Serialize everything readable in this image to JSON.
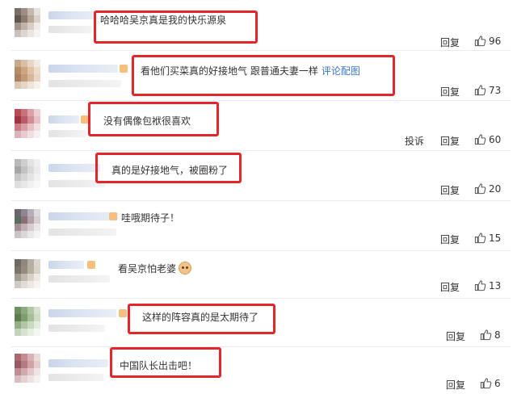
{
  "comments": [
    {
      "text": "哈哈哈吴京真是我的快乐源泉",
      "reply": "回复",
      "likes": "96",
      "avatar": [
        "#7a6f66",
        "#9c8e84",
        "#c4b7ad",
        "#e6e1dc",
        "#5f574f",
        "#8c7d70",
        "#b8a696",
        "#dad2ca",
        "#a09489",
        "#bfb3a7",
        "#d8cec5",
        "#efebe7",
        "#c9c1ba",
        "#ddd6d0",
        "#ebe6e2",
        "#f6f4f2"
      ]
    },
    {
      "text": "看他们买菜真的好接地气 跟普通夫妻一样",
      "link": "评论配图",
      "reply": "回复",
      "likes": "73",
      "avatar": [
        "#c7a98c",
        "#d9bfa6",
        "#e8d6c4",
        "#f3ebe2",
        "#b58c68",
        "#cfa47e",
        "#e0c2a4",
        "#eddccb",
        "#a98262",
        "#c19b79",
        "#d6b797",
        "#e8d6c3",
        "#dcc7b2",
        "#e6d5c4",
        "#efe4d9",
        "#f7f1eb"
      ]
    },
    {
      "text": "没有偶像包袱很喜欢",
      "report": "投诉",
      "reply": "回复",
      "likes": "60",
      "avatar": [
        "#b64a55",
        "#c9727c",
        "#dca1a8",
        "#ecd1d4",
        "#9d3541",
        "#b95c67",
        "#d18c95",
        "#e6c0c5",
        "#c77d86",
        "#d79ea5",
        "#e6c2c6",
        "#f2e1e3",
        "#dcb3b8",
        "#e7cbce",
        "#f0dee0",
        "#f8f0f1"
      ]
    },
    {
      "text": "真的是好接地气，被圈粉了",
      "reply": "回复",
      "likes": "20",
      "avatar": [
        "#b9b9b9",
        "#cfcfcf",
        "#e2e2e2",
        "#f0f0f0",
        "#a5a5a5",
        "#c2c2c2",
        "#d9d9d9",
        "#ebebeb",
        "#c6c6c6",
        "#d6d6d6",
        "#e5e5e5",
        "#f2f2f2",
        "#dedede",
        "#e8e8e8",
        "#f1f1f1",
        "#f8f8f8"
      ]
    },
    {
      "text": "哇哦期待子！",
      "reply": "回复",
      "likes": "15",
      "avatar": [
        "#6f6470",
        "#8f8590",
        "#b7afb7",
        "#dcd8dc",
        "#5a6e5e",
        "#8a6f78",
        "#b3a0a8",
        "#d8ced2",
        "#a38f96",
        "#c0b0b6",
        "#d8ccd0",
        "#ece6e8",
        "#c9c3c6",
        "#dcd7d9",
        "#eae7e8",
        "#f5f3f4"
      ]
    },
    {
      "text": "看吴京怕老婆",
      "emoji": true,
      "reply": "回复",
      "likes": "13",
      "avatar": [
        "#6e6961",
        "#8d877e",
        "#b4aea5",
        "#dad6d0",
        "#7b7369",
        "#958c80",
        "#b8afa3",
        "#d9d2c9",
        "#a49b90",
        "#c0b8ad",
        "#d8d1c8",
        "#ece8e2",
        "#cfcac3",
        "#e0dcd6",
        "#ece9e5",
        "#f6f4f1"
      ]
    },
    {
      "text": "这样的阵容真的是太期待了",
      "reply": "回复",
      "likes": "8",
      "avatar": [
        "#6e8f5e",
        "#8caa7d",
        "#b1c7a5",
        "#d7e3d0",
        "#5c7d4d",
        "#7f9e70",
        "#a6bf98",
        "#cfdcc6",
        "#93ad86",
        "#b0c5a4",
        "#cad9c0",
        "#e4ecdf",
        "#c4d3bb",
        "#d7e2d0",
        "#e7eee3",
        "#f3f7f1"
      ]
    },
    {
      "text": "中国队长出击吧！",
      "reply": "回复",
      "likes": "6",
      "avatar": [
        "#a86a6f",
        "#c28c90",
        "#d8b3b5",
        "#ecdadb",
        "#965a60",
        "#b57b80",
        "#cfa3a6",
        "#e5cccd",
        "#bd8f92",
        "#d0aaad",
        "#e1c7c9",
        "#f0e3e4",
        "#d8bec0",
        "#e4d1d2",
        "#eee2e3",
        "#f7f0f1"
      ]
    }
  ]
}
